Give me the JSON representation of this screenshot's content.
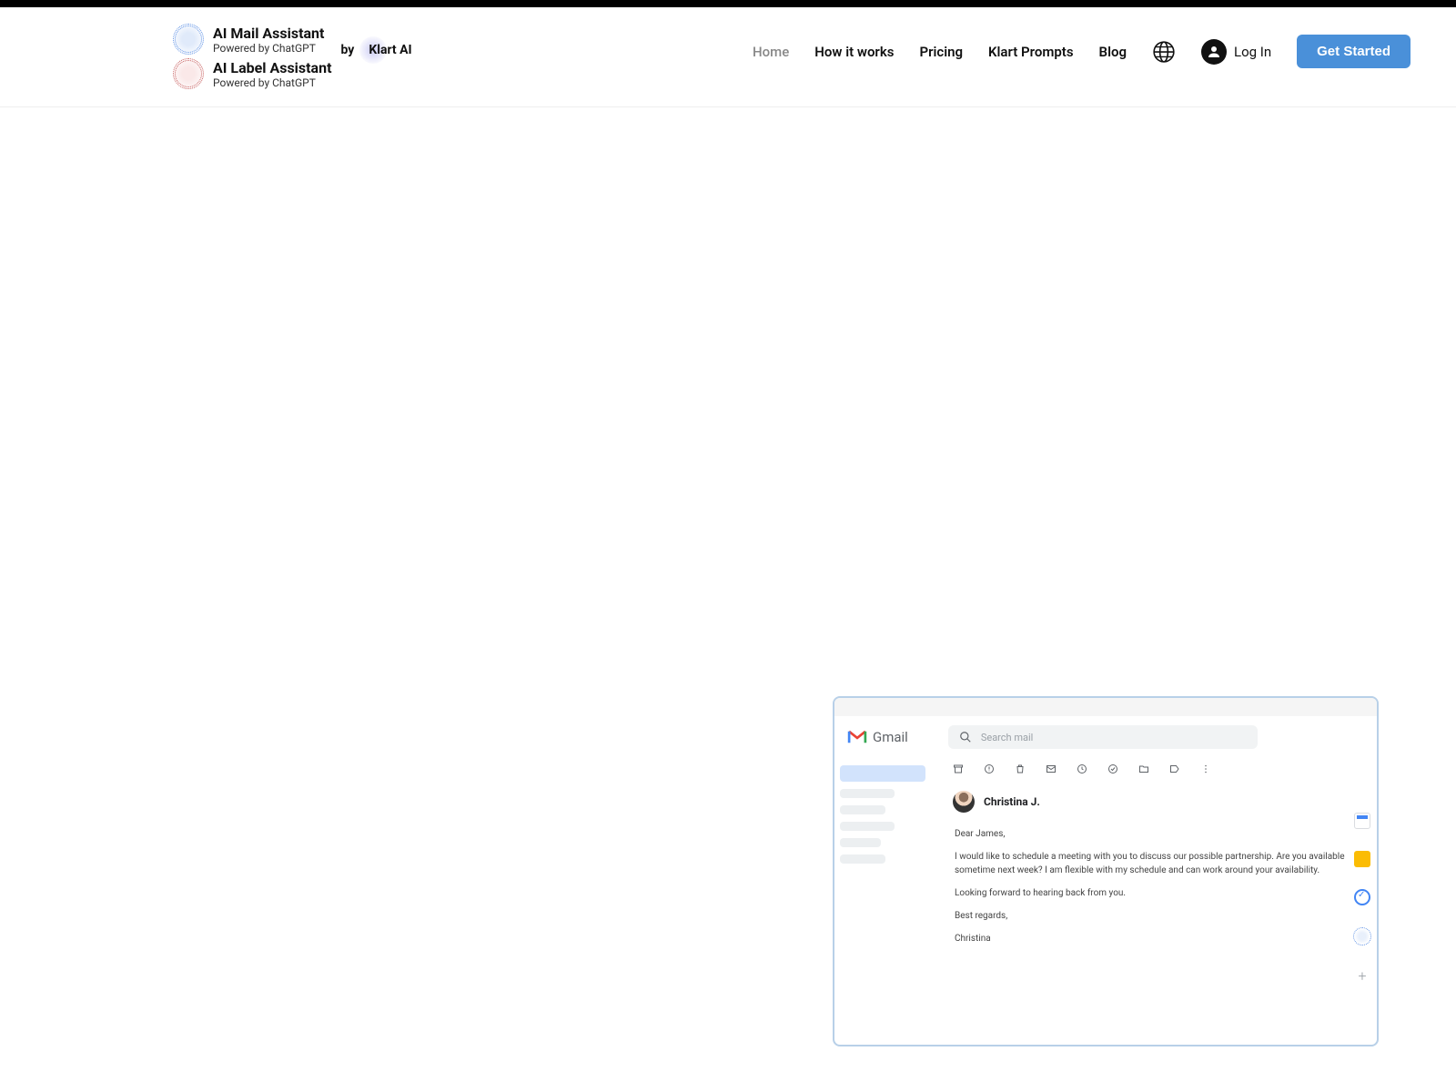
{
  "header": {
    "logos": [
      {
        "title": "AI Mail Assistant",
        "sub": "Powered by ChatGPT"
      },
      {
        "title": "AI Label Assistant",
        "sub": "Powered by ChatGPT"
      }
    ],
    "by_text": "by",
    "brand": "Klart AI",
    "nav": {
      "home": "Home",
      "how": "How it works",
      "pricing": "Pricing",
      "prompts": "Klart Prompts",
      "blog": "Blog"
    },
    "login": "Log In",
    "cta": "Get Started"
  },
  "gmail": {
    "brand": "Gmail",
    "search_placeholder": "Search mail",
    "sender": "Christina J.",
    "body": {
      "greeting": "Dear James,",
      "p1": "I would like to schedule a meeting with you to discuss our possible partnership. Are you available sometime next week? I am flexible with my schedule and can work around your availability.",
      "p2": "Looking forward to hearing back from you.",
      "signoff": "Best regards,",
      "name": "Christina"
    }
  }
}
